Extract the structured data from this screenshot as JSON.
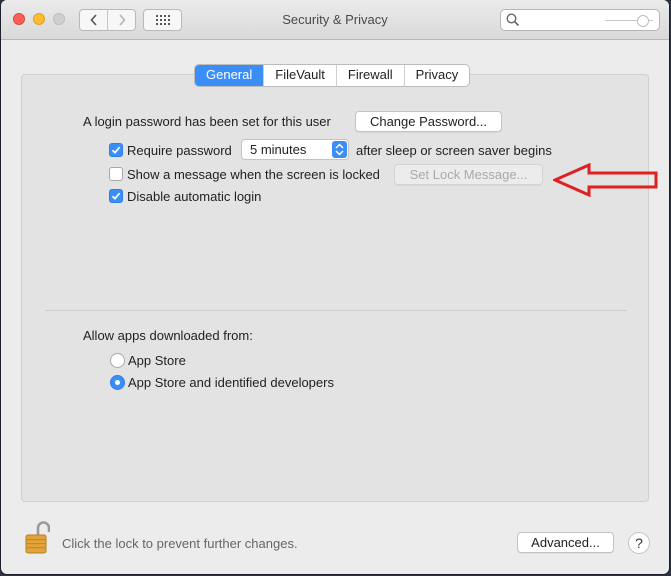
{
  "window": {
    "title": "Security & Privacy",
    "search_placeholder": ""
  },
  "tabs": [
    {
      "label": "General",
      "active": true
    },
    {
      "label": "FileVault",
      "active": false
    },
    {
      "label": "Firewall",
      "active": false
    },
    {
      "label": "Privacy",
      "active": false
    }
  ],
  "general": {
    "login_text": "A login password has been set for this user",
    "change_password_label": "Change Password...",
    "require_password_label": "Require password",
    "require_password_checked": true,
    "require_password_value": "5 minutes",
    "after_sleep_text": "after sleep or screen saver begins",
    "show_message_label": "Show a message when the screen is locked",
    "show_message_checked": false,
    "set_lock_message_label": "Set Lock Message...",
    "disable_login_label": "Disable automatic login",
    "disable_login_checked": true
  },
  "apps": {
    "heading": "Allow apps downloaded from:",
    "options": [
      {
        "label": "App Store",
        "selected": false
      },
      {
        "label": "App Store and identified developers",
        "selected": true
      }
    ]
  },
  "footer": {
    "lock_text": "Click the lock to prevent further changes.",
    "advanced_label": "Advanced...",
    "help_label": "?"
  },
  "colors": {
    "accent": "#3a8ef6",
    "annotation_arrow": "#e02020"
  }
}
